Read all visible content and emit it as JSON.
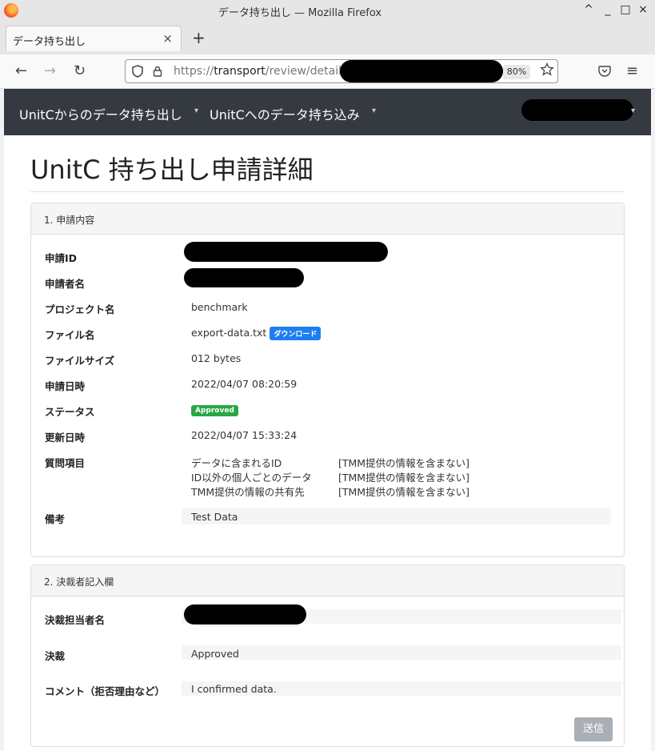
{
  "window": {
    "title": "データ持ち出し — Mozilla Firefox",
    "controls": [
      "^",
      "_",
      "□",
      "×"
    ]
  },
  "tab": {
    "label": "データ持ち出し",
    "close": "×",
    "new_tab": "+"
  },
  "nav": {
    "back": "←",
    "forward": "→",
    "reload": "↻",
    "menu": "≡",
    "url_prefix": "https://",
    "url_host": "transport",
    "url_path": "/review/detail/",
    "zoom": "80%"
  },
  "appnav": {
    "items": [
      "UnitCからのデータ持ち出し",
      "UnitCへのデータ持ち込み"
    ],
    "caret": "▾"
  },
  "page_title": "UnitC 持ち出し申請詳細",
  "section1": {
    "header": "1. 申請内容",
    "labels": {
      "id": "申請ID",
      "applicant": "申請者名",
      "project": "プロジェクト名",
      "file": "ファイル名",
      "size": "ファイルサイズ",
      "date": "申請日時",
      "status": "ステータス",
      "updated": "更新日時",
      "questions": "質問項目",
      "note": "備考"
    },
    "values": {
      "project": "benchmark",
      "file": "export-data.txt",
      "download": "ダウンロード",
      "size": "012 bytes",
      "date": "2022/04/07 08:20:59",
      "status": "Approved",
      "updated": "2022/04/07 15:33:24",
      "note": "Test Data"
    },
    "questions": [
      {
        "item": "データに含まれるID",
        "answer": "[TMM提供の情報を含まない]"
      },
      {
        "item": "ID以外の個人ごとのデータ",
        "answer": "[TMM提供の情報を含まない]"
      },
      {
        "item": "TMM提供の情報の共有先",
        "answer": "[TMM提供の情報を含まない]"
      }
    ]
  },
  "section2": {
    "header": "2. 決裁者記入欄",
    "labels": {
      "approver": "決裁担当者名",
      "decision": "決裁",
      "comment": "コメント（拒否理由など）"
    },
    "values": {
      "decision": "Approved",
      "comment": "I confirmed data."
    },
    "send": "送信"
  }
}
